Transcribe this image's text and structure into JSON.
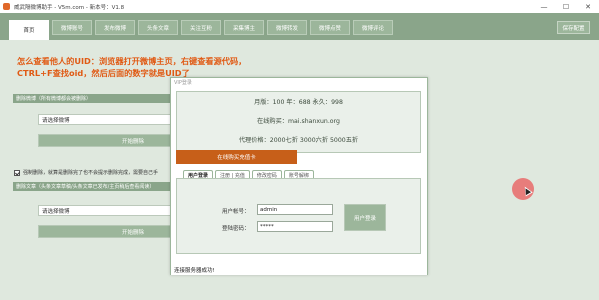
{
  "window": {
    "title": "威武隔微博助手 - V5m.com - 新本号：V1.8",
    "minimize": "—",
    "maximize": "☐",
    "close": "✕"
  },
  "nav": {
    "tabs": [
      "首页",
      "微博账号",
      "发布微博",
      "头条文章",
      "关注互粉",
      "采集博主",
      "微博转发",
      "微博点赞",
      "微博评论"
    ],
    "active_index": 0,
    "save_label": "保存配置"
  },
  "main": {
    "hint_line1": "怎么查看他人的UID：浏览器打开微博主页，右键查看源代码，",
    "hint_line2": "CTRL+F查找oid，然后后面的数字就是UID了",
    "section1_header": "删除微博（所有微博都会被删除）",
    "select1_value": "请选择微博",
    "button1_label": "开始删除",
    "checkbox_label": "强制删除，就算是删除完了也不会提示删除完成，需要自己手",
    "section2_header": "删除文章（头条文章草稿/头条文章已发布/主页稍后查看阅读）",
    "select2_value": "请选择微博",
    "button2_label": "开始删除"
  },
  "dialog": {
    "title": "VIP登录",
    "info_line1": "月版：100 年：688 永久：998",
    "info_line2": "在线购买：mai.shanxun.org",
    "info_line3": "代理价格：2000七折 3000六折 5000五折",
    "buy_label": "在线购买充值卡",
    "tabs": [
      "用户登录",
      "注册 | 充值",
      "修改密码",
      "账号解绑"
    ],
    "active_tab": 0,
    "account_label": "用户帐号：",
    "account_value": "admin",
    "password_label": "登陆密码：",
    "password_value": "*****",
    "login_label": "用户登录",
    "status": "连接服务器成功!"
  },
  "colors": {
    "nav_bg": "#8aa58a",
    "accent_orange": "#c75f19",
    "hint_text": "#e05a14"
  }
}
